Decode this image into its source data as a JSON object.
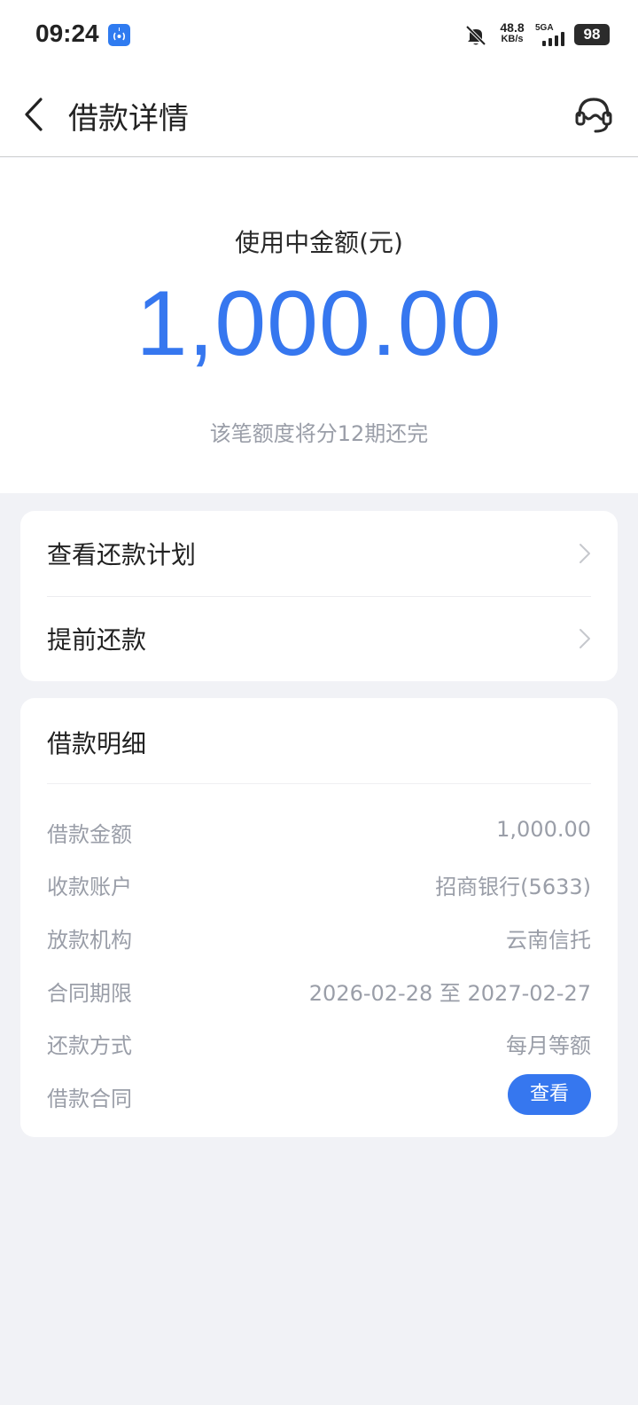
{
  "status_bar": {
    "time": "09:24",
    "app_icon": "broadcast-icon",
    "bell_icon": "bell-muted-icon",
    "net_speed_value": "48.8",
    "net_speed_unit": "KB/s",
    "network_label": "5GA",
    "battery": "98"
  },
  "header": {
    "back_icon": "chevron-left-icon",
    "title": "借款详情",
    "service_icon": "headset-icon"
  },
  "hero": {
    "label": "使用中金额(元)",
    "amount": "1,000.00",
    "note": "该笔额度将分12期还完"
  },
  "menu": {
    "items": [
      {
        "label": "查看还款计划"
      },
      {
        "label": "提前还款"
      }
    ]
  },
  "details": {
    "title": "借款明细",
    "rows": [
      {
        "key": "借款金额",
        "value": "1,000.00"
      },
      {
        "key": "收款账户",
        "value": "招商银行(5633)"
      },
      {
        "key": "放款机构",
        "value": "云南信托"
      },
      {
        "key": "合同期限",
        "value": "2026-02-28 至 2027-02-27"
      },
      {
        "key": "还款方式",
        "value": "每月等额"
      },
      {
        "key": "借款合同",
        "button": "查看"
      }
    ]
  },
  "colors": {
    "accent": "#3677ef",
    "background": "#f1f2f6",
    "muted_text": "#9a9ea8"
  }
}
